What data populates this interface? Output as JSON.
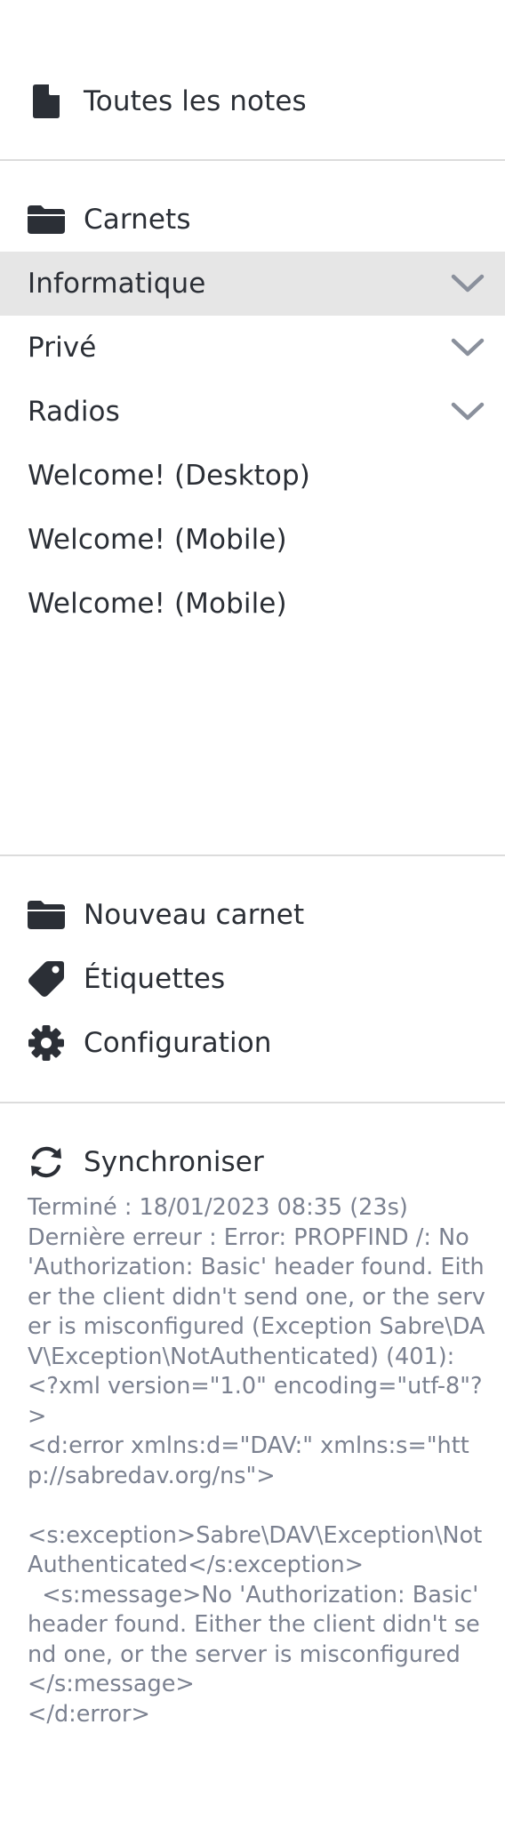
{
  "all_notes": {
    "label": "Toutes les notes",
    "icon": "file-icon"
  },
  "notebooks_header": {
    "label": "Carnets",
    "icon": "folder-icon"
  },
  "notebooks": [
    {
      "label": "Informatique",
      "has_children": true,
      "selected": true
    },
    {
      "label": "Privé",
      "has_children": true,
      "selected": false
    },
    {
      "label": "Radios",
      "has_children": true,
      "selected": false
    },
    {
      "label": "Welcome! (Desktop)",
      "has_children": false,
      "selected": false
    },
    {
      "label": "Welcome! (Mobile)",
      "has_children": false,
      "selected": false
    },
    {
      "label": "Welcome! (Mobile)",
      "has_children": false,
      "selected": false
    }
  ],
  "actions": {
    "new_notebook": {
      "label": "Nouveau carnet",
      "icon": "folder-icon"
    },
    "tags": {
      "label": "Étiquettes",
      "icon": "tag-icon"
    },
    "configuration": {
      "label": "Configuration",
      "icon": "gear-icon"
    }
  },
  "sync": {
    "label": "Synchroniser",
    "icon": "sync-icon",
    "status": "Terminé : 18/01/2023 08:35 (23s)\nDernière erreur : Error: PROPFIND /: No 'Authorization: Basic' header found. Either the client didn't send one, or the server is misconfigured (Exception Sabre\\DAV\\Exception\\NotAuthenticated) (401): <?xml version=\"1.0\" encoding=\"utf-8\"?>\n<d:error xmlns:d=\"DAV:\" xmlns:s=\"http://sabredav.org/ns\">\n\n<s:exception>Sabre\\DAV\\Exception\\NotAuthenticated</s:exception>\n  <s:message>No 'Authorization: Basic' header found. Either the client didn't send one, or the server is misconfigured</s:message>\n</d:error>"
  },
  "colors": {
    "text": "#2b2f36",
    "muted_text": "#7b8190",
    "selected_bg": "#e6e6e6",
    "divider": "#dcdcdc",
    "chevron": "#8a909c"
  }
}
